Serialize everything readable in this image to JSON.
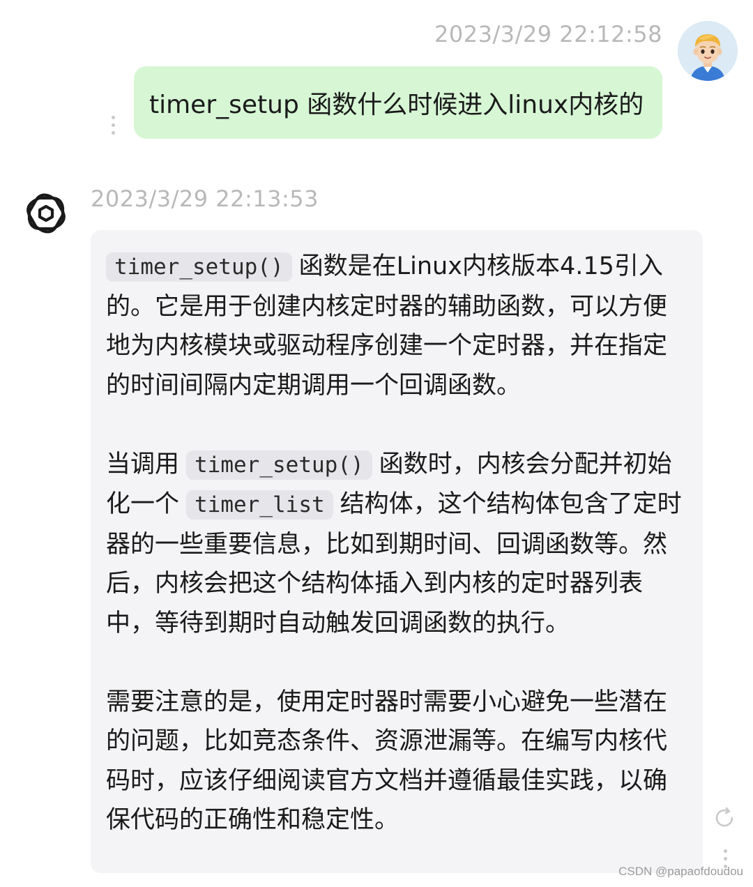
{
  "user_message": {
    "timestamp": "2023/3/29 22:12:58",
    "text": "timer_setup 函数什么时候进入linux内核的"
  },
  "bot_message": {
    "timestamp": "2023/3/29 22:13:53",
    "paragraphs": [
      {
        "code_1": "timer_setup()",
        "text_1": "函数是在Linux内核版本4.15引入的。它是用于创建内核定时器的辅助函数，可以方便地为内核模块或驱动程序创建一个定时器，并在指定的时间间隔内定期调用一个回调函数。"
      },
      {
        "text_0": "当调用",
        "code_1": "timer_setup()",
        "text_1": "函数时，内核会分配并初始化一个",
        "code_2": "timer_list",
        "text_2": "结构体，这个结构体包含了定时器的一些重要信息，比如到期时间、回调函数等。然后，内核会把这个结构体插入到内核的定时器列表中，等待到期时自动触发回调函数的执行。"
      },
      {
        "text_1": "需要注意的是，使用定时器时需要小心避免一些潜在的问题，比如竞态条件、资源泄漏等。在编写内核代码时，应该仔细阅读官方文档并遵循最佳实践，以确保代码的正确性和稳定性。"
      }
    ]
  },
  "watermark": "CSDN @papaofdoudou",
  "icons": {
    "user_avatar": "cartoon-boy-avatar",
    "bot_avatar": "openai-logo-icon",
    "more": "vertical-dots-icon",
    "regenerate": "refresh-icon"
  },
  "colors": {
    "user_bubble": "#d6f6d4",
    "bot_bubble": "#f4f4f6",
    "timestamp": "#b8b8b8",
    "inline_code_bg": "#e6e6ea"
  }
}
